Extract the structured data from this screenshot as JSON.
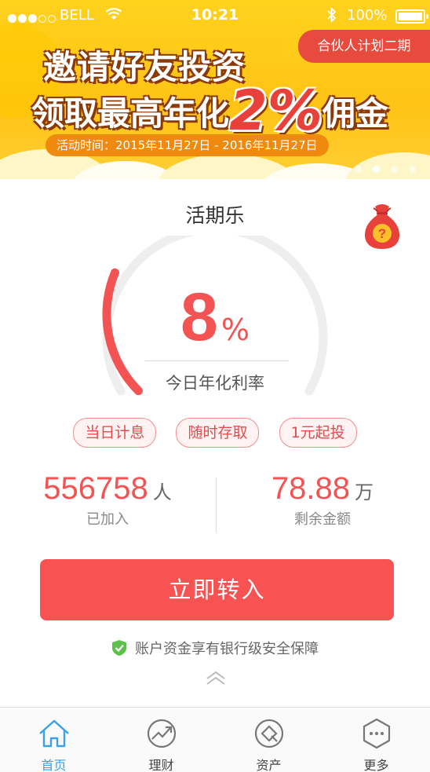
{
  "status_bar": {
    "carrier": "BELL",
    "time": "10:21",
    "battery": "100%"
  },
  "banner": {
    "ribbon": "合伙人计划二期",
    "line1": "邀请好友投资",
    "line2_prefix": "领取最高年化",
    "line2_highlight": "2%",
    "line2_suffix": "佣金",
    "activity_time": "活动时间：2015年11月27日 - 2016年11月27日",
    "pages": 4,
    "active_page": 2
  },
  "product": {
    "title": "活期乐",
    "rate_value": "8",
    "rate_unit": "%",
    "rate_label": "今日年化利率",
    "gauge_fraction": 0.25
  },
  "tags": [
    "当日计息",
    "随时存取",
    "1元起投"
  ],
  "stats": {
    "joined": {
      "value": "556758",
      "unit": "人",
      "label": "已加入"
    },
    "remaining": {
      "value": "78.88",
      "unit": "万",
      "label": "剩余金额"
    }
  },
  "cta_label": "立即转入",
  "safety_text": "账户资金享有银行级安全保障",
  "tabs": [
    {
      "label": "首页",
      "icon": "home-icon",
      "active": true
    },
    {
      "label": "理财",
      "icon": "chart-trend-icon",
      "active": false
    },
    {
      "label": "资产",
      "icon": "assets-icon",
      "active": false
    },
    {
      "label": "更多",
      "icon": "more-icon",
      "active": false
    }
  ],
  "colors": {
    "accent": "#f85252",
    "banner_yellow": "#ffc315",
    "tab_active": "#3aa0e8",
    "safe_green": "#5cc04b"
  }
}
